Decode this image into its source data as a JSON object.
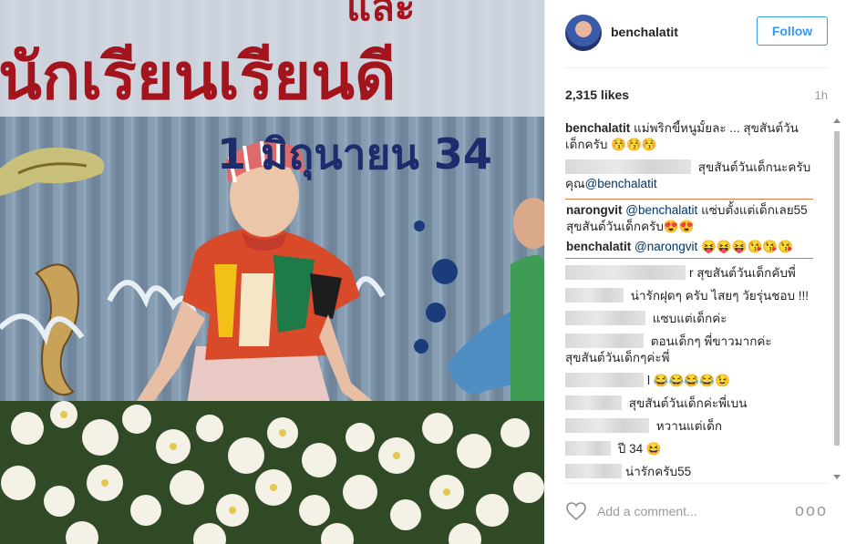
{
  "post": {
    "username": "benchalatit",
    "follow_label": "Follow",
    "likes": "2,315 likes",
    "time": "1h",
    "add_comment_placeholder": "Add a comment...",
    "more_label": "ooo"
  },
  "photo": {
    "banner_line1": "และ",
    "banner_line2": "นักเรียนเรียนดี",
    "banner_date": "1 มิถุนายน 34"
  },
  "comments": [
    {
      "user": "benchalatit",
      "text": "แม่พริกขี้หนูมั้ยละ ... สุขสันต์วันเด็กครับ 😚😚😚"
    },
    {
      "text": "สุขสันต์วันเด็กนะครับคุณ",
      "mention": "@benchalatit"
    },
    {
      "user": "narongvit",
      "mention": "@benchalatit",
      "text": "แซ่บตั้งแต่เด็กเลย55 สุขสันต์วันเด็กครับ😍😍"
    },
    {
      "user": "benchalatit",
      "mention": "@narongvit",
      "text": "😝😝😝😘😘😘"
    },
    {
      "text": "r สุขสันต์วันเด็กคับพี่"
    },
    {
      "text": "น่ารักฝุดๆ ครับ ไสยๆ วัยรุ่นชอบ !!!"
    },
    {
      "text": "แซบแต่เด็กค่ะ"
    },
    {
      "text": "ตอนเด็กๆ พี่ขาวมากค่ะ สุขสันต์วันเด็กๆค่ะพี่"
    },
    {
      "text": "l 😂😂😂😂😉"
    },
    {
      "text": "สุขสันต์วันเด็กค่ะพี่เบน"
    },
    {
      "text": "หวานแต่เด็ก"
    },
    {
      "text": "ปี 34 😆"
    },
    {
      "text": "น่ารักครับ55"
    }
  ]
}
